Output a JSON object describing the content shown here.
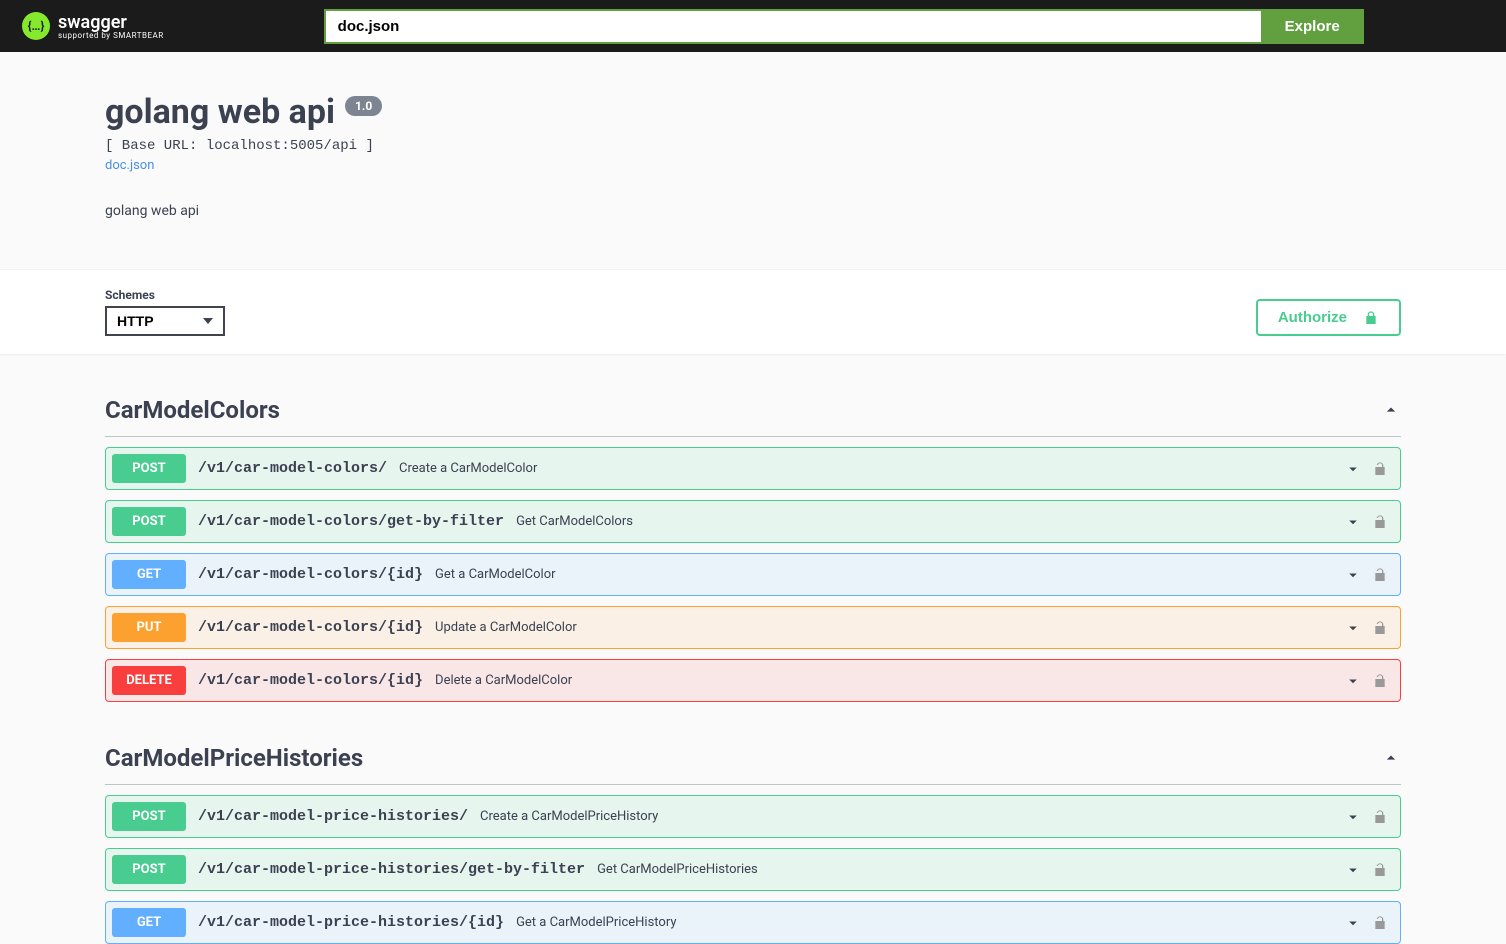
{
  "topbar": {
    "logo_text": "swagger",
    "logo_sub": "supported by SMARTBEAR",
    "search_value": "doc.json",
    "explore_label": "Explore"
  },
  "info": {
    "title": "golang web api",
    "version": "1.0",
    "base_url_label": "[ Base URL: localhost:5005/api ]",
    "doc_link_label": "doc.json",
    "description": "golang web api"
  },
  "schemes": {
    "label": "Schemes",
    "selected": "HTTP",
    "authorize_label": "Authorize"
  },
  "tags": [
    {
      "name": "CarModelColors",
      "ops": [
        {
          "method": "POST",
          "css": "post",
          "path": "/v1/car-model-colors/",
          "summary": "Create a CarModelColor"
        },
        {
          "method": "POST",
          "css": "post",
          "path": "/v1/car-model-colors/get-by-filter",
          "summary": "Get CarModelColors"
        },
        {
          "method": "GET",
          "css": "get",
          "path": "/v1/car-model-colors/{id}",
          "summary": "Get a CarModelColor"
        },
        {
          "method": "PUT",
          "css": "put",
          "path": "/v1/car-model-colors/{id}",
          "summary": "Update a CarModelColor"
        },
        {
          "method": "DELETE",
          "css": "delete",
          "path": "/v1/car-model-colors/{id}",
          "summary": "Delete a CarModelColor"
        }
      ]
    },
    {
      "name": "CarModelPriceHistories",
      "ops": [
        {
          "method": "POST",
          "css": "post",
          "path": "/v1/car-model-price-histories/",
          "summary": "Create a CarModelPriceHistory"
        },
        {
          "method": "POST",
          "css": "post",
          "path": "/v1/car-model-price-histories/get-by-filter",
          "summary": "Get CarModelPriceHistories"
        },
        {
          "method": "GET",
          "css": "get",
          "path": "/v1/car-model-price-histories/{id}",
          "summary": "Get a CarModelPriceHistory"
        }
      ]
    }
  ]
}
